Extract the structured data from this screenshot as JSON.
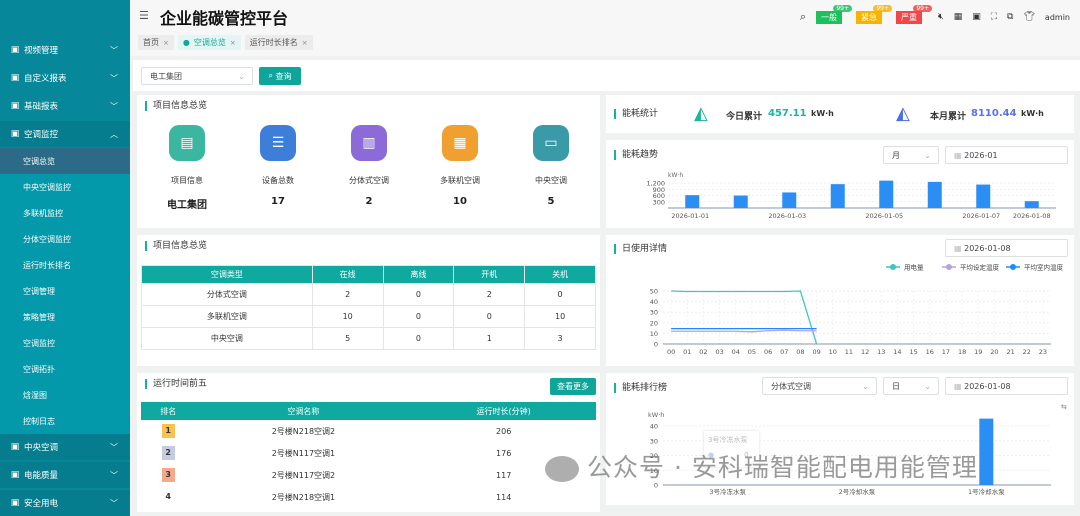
{
  "sidebar": {
    "items": [
      {
        "label": "视频管理",
        "icon": "camera-icon"
      },
      {
        "label": "自定义报表",
        "icon": "report-icon"
      },
      {
        "label": "基础报表",
        "icon": "monitor-icon"
      },
      {
        "label": "空调监控",
        "icon": "air-conditioner-icon"
      }
    ],
    "sub_items": [
      "空调总览",
      "中央空调监控",
      "多联机监控",
      "分体空调监控",
      "运行时长排名",
      "空调管理",
      "策略管理",
      "空调监控",
      "空调拓扑",
      "焓湿图",
      "控制日志"
    ],
    "bottom_items": [
      {
        "label": "中央空调",
        "icon": "central-ac-icon"
      },
      {
        "label": "电能质量",
        "icon": "power-quality-icon"
      },
      {
        "label": "安全用电",
        "icon": "safety-icon"
      }
    ]
  },
  "header": {
    "title": "企业能碳管控平台",
    "tabs": [
      "首页",
      "空调总览",
      "运行时长排名"
    ],
    "badges": [
      {
        "label": "一般",
        "count": "99+",
        "color": "#1fbf5f"
      },
      {
        "label": "紧急",
        "count": "99+",
        "color": "#f6b400"
      },
      {
        "label": "严重",
        "count": "99+",
        "color": "#f04848"
      }
    ],
    "user": "admin"
  },
  "filter": {
    "company": "电工集团",
    "query_label": "查询"
  },
  "overview": {
    "title": "项目信息总览",
    "items": [
      {
        "label": "项目信息",
        "value": "电工集团",
        "color": "#3bb6a0"
      },
      {
        "label": "设备总数",
        "value": "17",
        "color": "#3d7fd8"
      },
      {
        "label": "分体式空调",
        "value": "2",
        "color": "#8c6bd8"
      },
      {
        "label": "多联机空调",
        "value": "10",
        "color": "#f0a030"
      },
      {
        "label": "中央空调",
        "value": "5",
        "color": "#3a9aa8"
      }
    ]
  },
  "status_table": {
    "title": "项目信息总览",
    "headers": [
      "空调类型",
      "在线",
      "离线",
      "开机",
      "关机"
    ],
    "rows": [
      [
        "分体式空调",
        "2",
        "0",
        "2",
        "0"
      ],
      [
        "多联机空调",
        "10",
        "0",
        "0",
        "10"
      ],
      [
        "中央空调",
        "5",
        "0",
        "1",
        "3"
      ]
    ]
  },
  "top5": {
    "title": "运行时间前五",
    "more_label": "查看更多",
    "headers": [
      "排名",
      "空调名称",
      "运行时长(分钟)"
    ],
    "rows": [
      [
        "1",
        "2号楼N218空调2",
        "206"
      ],
      [
        "2",
        "2号楼N117空调1",
        "176"
      ],
      [
        "3",
        "2号楼N117空调2",
        "117"
      ],
      [
        "4",
        "2号楼N218空调1",
        "114"
      ]
    ]
  },
  "energy_stats": {
    "title": "能耗统计",
    "today_label": "今日累计",
    "today_value": "457.11",
    "month_label": "本月累计",
    "month_value": "8110.44",
    "unit": "kW·h"
  },
  "trend": {
    "title": "能耗趋势",
    "period": "月",
    "date": "2026-01"
  },
  "daily": {
    "title": "日使用详情",
    "date": "2026-01-08"
  },
  "ranking": {
    "title": "能耗排行榜",
    "type": "分体式空调",
    "period": "日",
    "date": "2026-01-08",
    "tooltip_name": "3号冷冻水泵",
    "tooltip_value": "0"
  },
  "watermark": "公众号 · 安科瑞智能配电用能管理",
  "chart_data": [
    {
      "type": "bar",
      "title": "能耗趋势",
      "ylabel": "kW·h",
      "categories": [
        "2026-01-01",
        "2026-01-02",
        "2026-01-03",
        "2026-01-04",
        "2026-01-05",
        "2026-01-06",
        "2026-01-07",
        "2026-01-08"
      ],
      "shown_xticks": [
        "2026-01-01",
        "2026-01-03",
        "2026-01-05",
        "2026-01-07",
        "2026-01-08"
      ],
      "values": [
        620,
        600,
        750,
        1150,
        1320,
        1260,
        1130,
        330
      ],
      "yticks": [
        "300",
        "600",
        "900",
        "1,200"
      ],
      "ylim": [
        0,
        1350
      ]
    },
    {
      "type": "line",
      "title": "日使用详情",
      "x": [
        "00",
        "01",
        "02",
        "03",
        "04",
        "05",
        "06",
        "07",
        "08",
        "09",
        "10",
        "11",
        "12",
        "13",
        "14",
        "15",
        "16",
        "17",
        "18",
        "19",
        "20",
        "21",
        "22",
        "23"
      ],
      "series": [
        {
          "name": "用电量",
          "color": "#3cc8c0",
          "values": [
            50,
            49.5,
            49.5,
            49.5,
            49.5,
            49.5,
            49.5,
            49.5,
            50,
            0
          ]
        },
        {
          "name": "平均设定温度",
          "color": "#b7a1e6",
          "values": [
            12,
            12,
            12,
            12,
            12,
            11.5,
            12.5,
            13,
            12.5,
            12.5
          ]
        },
        {
          "name": "平均室内温度",
          "color": "#1a8cff",
          "values": [
            14.5,
            14.5,
            14.5,
            14.5,
            14.5,
            14.5,
            14.5,
            14.5,
            14.5,
            14.5
          ]
        }
      ],
      "yticks": [
        "0",
        "10",
        "20",
        "30",
        "40",
        "50"
      ],
      "ylim": [
        0,
        55
      ]
    },
    {
      "type": "bar",
      "title": "能耗排行榜",
      "ylabel": "kW·h",
      "categories": [
        "3号冷冻水泵",
        "2号冷却水泵",
        "1号冷却水泵"
      ],
      "values": [
        0,
        0,
        45
      ],
      "yticks": [
        "0",
        "10",
        "20",
        "30",
        "40"
      ],
      "ylim": [
        0,
        48
      ]
    }
  ]
}
